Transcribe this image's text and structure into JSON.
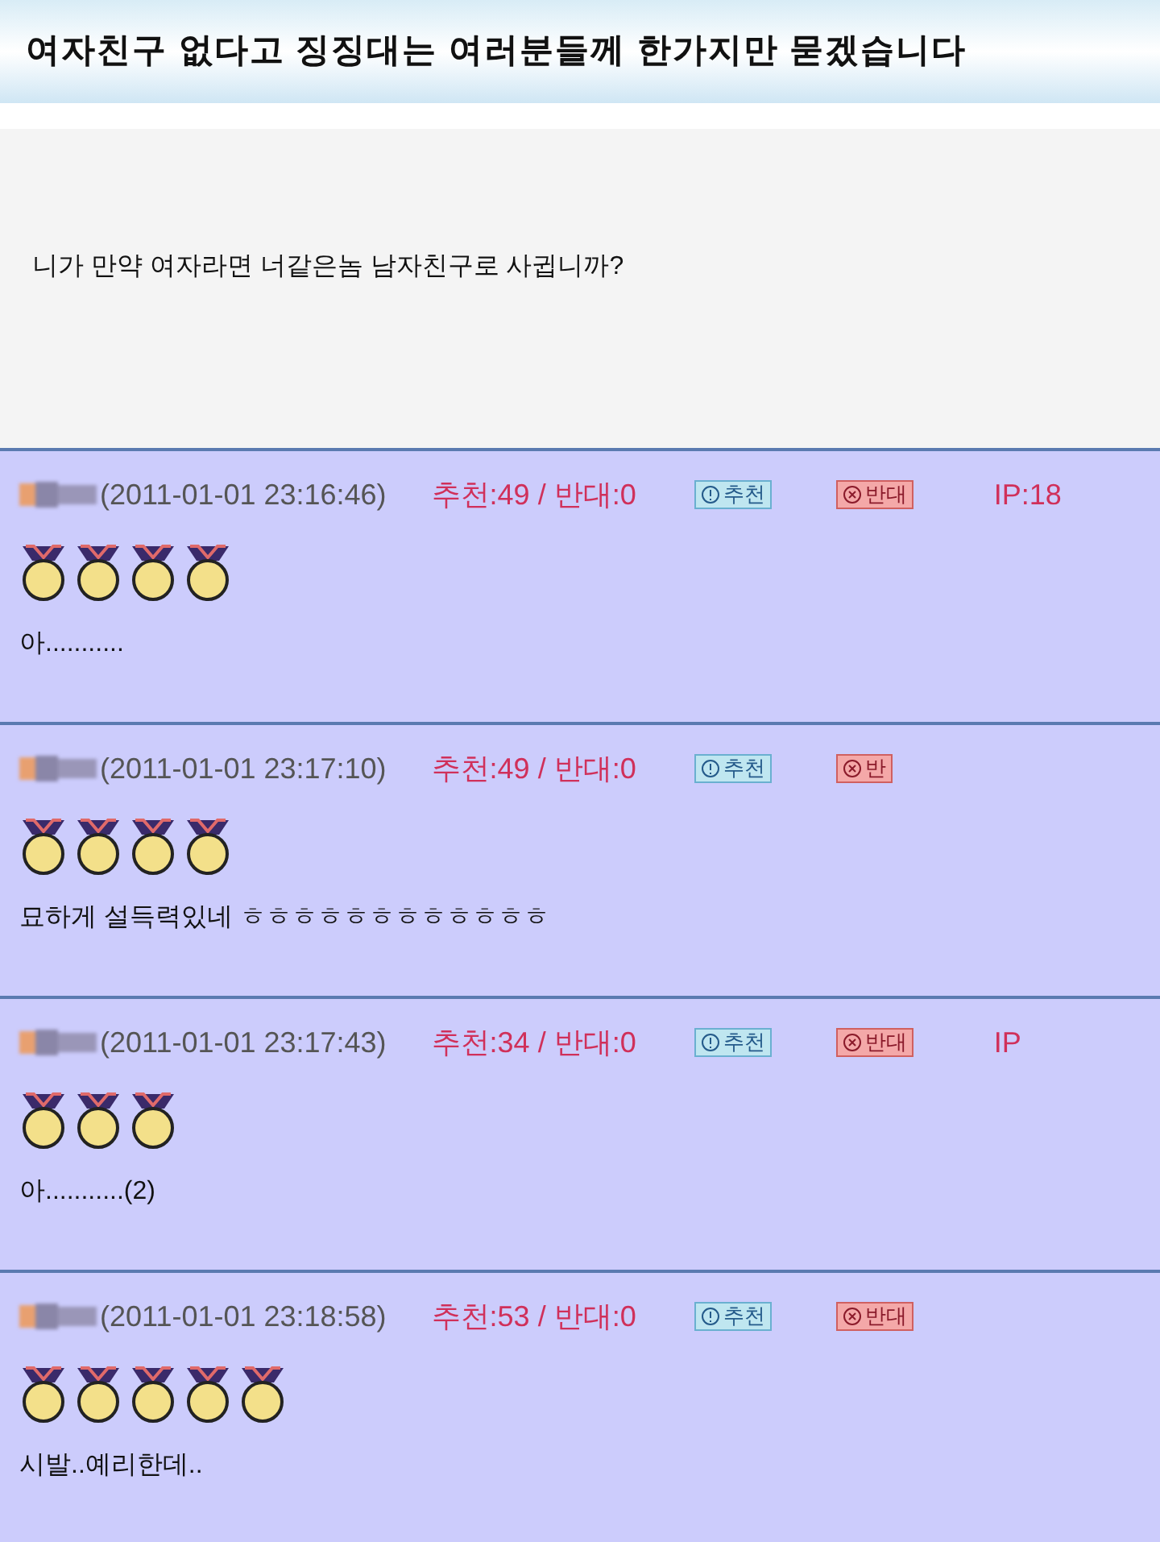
{
  "title": "여자친구 없다고 징징대는 여러분들께 한가지만 묻겠습니다",
  "post": {
    "body": "니가 만약 여자라면 너같은놈 남자친구로 사귑니까?"
  },
  "comments": [
    {
      "timestamp": "(2011-01-01 23:16:46)",
      "votes": "추천:49 / 반대:0",
      "recommend": "추천",
      "oppose": "반대",
      "ip": "IP:18",
      "stars": 4,
      "text": "아..........."
    },
    {
      "timestamp": "(2011-01-01 23:17:10)",
      "votes": "추천:49 / 반대:0",
      "recommend": "추천",
      "oppose": "반",
      "stars": 4,
      "text": "묘하게 설득력있네 ㅎㅎㅎㅎㅎㅎㅎㅎㅎㅎㅎㅎ"
    },
    {
      "timestamp": "(2011-01-01 23:17:43)",
      "votes": "추천:34 / 반대:0",
      "recommend": "추천",
      "oppose": "반대",
      "ip": "IP",
      "stars": 3,
      "text": "아...........(2)"
    },
    {
      "timestamp": "(2011-01-01 23:18:58)",
      "votes": "추천:53 / 반대:0",
      "recommend": "추천",
      "oppose": "반대",
      "stars": 5,
      "text": "시발..예리한데.."
    }
  ]
}
